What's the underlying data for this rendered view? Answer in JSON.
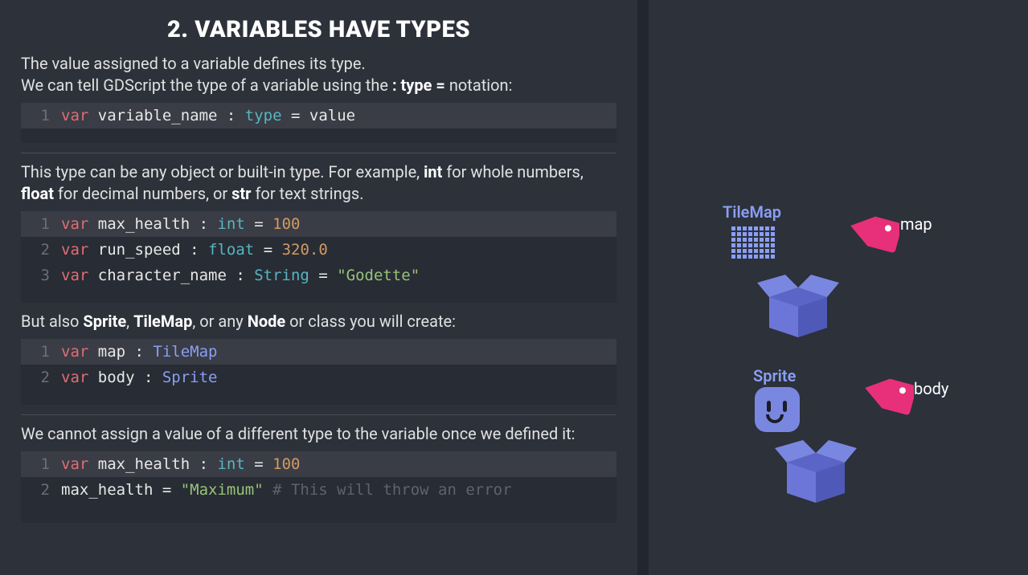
{
  "title": "2. VARIABLES HAVE TYPES",
  "intro_line1": "The value assigned to a variable defines its type.",
  "intro_line2_a": "We can tell GDScript the type of a variable using the ",
  "intro_line2_b": ": type =",
  "intro_line2_c": " notation:",
  "code1": {
    "ln": "1",
    "kw": "var",
    "name": " variable_name : ",
    "type": "type",
    "rest": " = value"
  },
  "para2_a": "This type can be any object or built-in type. For example, ",
  "para2_b": "int",
  "para2_c": " for whole numbers, ",
  "para2_d": "float",
  "para2_e": " for decimal numbers, or ",
  "para2_f": "str",
  "para2_g": " for text strings.",
  "code2": {
    "lines": [
      {
        "ln": "1",
        "kw": "var",
        "name": " max_health : ",
        "type": "int",
        "eq": " = ",
        "val": "100",
        "valClass": "num"
      },
      {
        "ln": "2",
        "kw": "var",
        "name": " run_speed : ",
        "type": "float",
        "eq": " = ",
        "val": "320.0",
        "valClass": "num"
      },
      {
        "ln": "3",
        "kw": "var",
        "name": " character_name : ",
        "type": "String",
        "eq": " = ",
        "val": "\"Godette\"",
        "valClass": "str"
      }
    ]
  },
  "para3_a": "But also ",
  "para3_b": "Sprite",
  "para3_c": ", ",
  "para3_d": "TileMap",
  "para3_e": ", or any ",
  "para3_f": "Node",
  "para3_g": " or class you will create:",
  "code3": {
    "lines": [
      {
        "ln": "1",
        "kw": "var",
        "name": " map : ",
        "type": "TileMap"
      },
      {
        "ln": "2",
        "kw": "var",
        "name": " body : ",
        "type": "Sprite"
      }
    ]
  },
  "para4": "We cannot assign a value of a different type to the variable once we defined it:",
  "code4": {
    "l1": {
      "ln": "1",
      "kw": "var",
      "name": " max_health : ",
      "type": "int",
      "eq": " = ",
      "val": "100"
    },
    "l2": {
      "ln": "2",
      "text": "max_health = ",
      "str": "\"Maximum\"",
      "comment": " # This will throw an error"
    }
  },
  "right": {
    "tilemap_label": "TileMap",
    "map_label": "map",
    "sprite_label": "Sprite",
    "body_label": "body"
  }
}
